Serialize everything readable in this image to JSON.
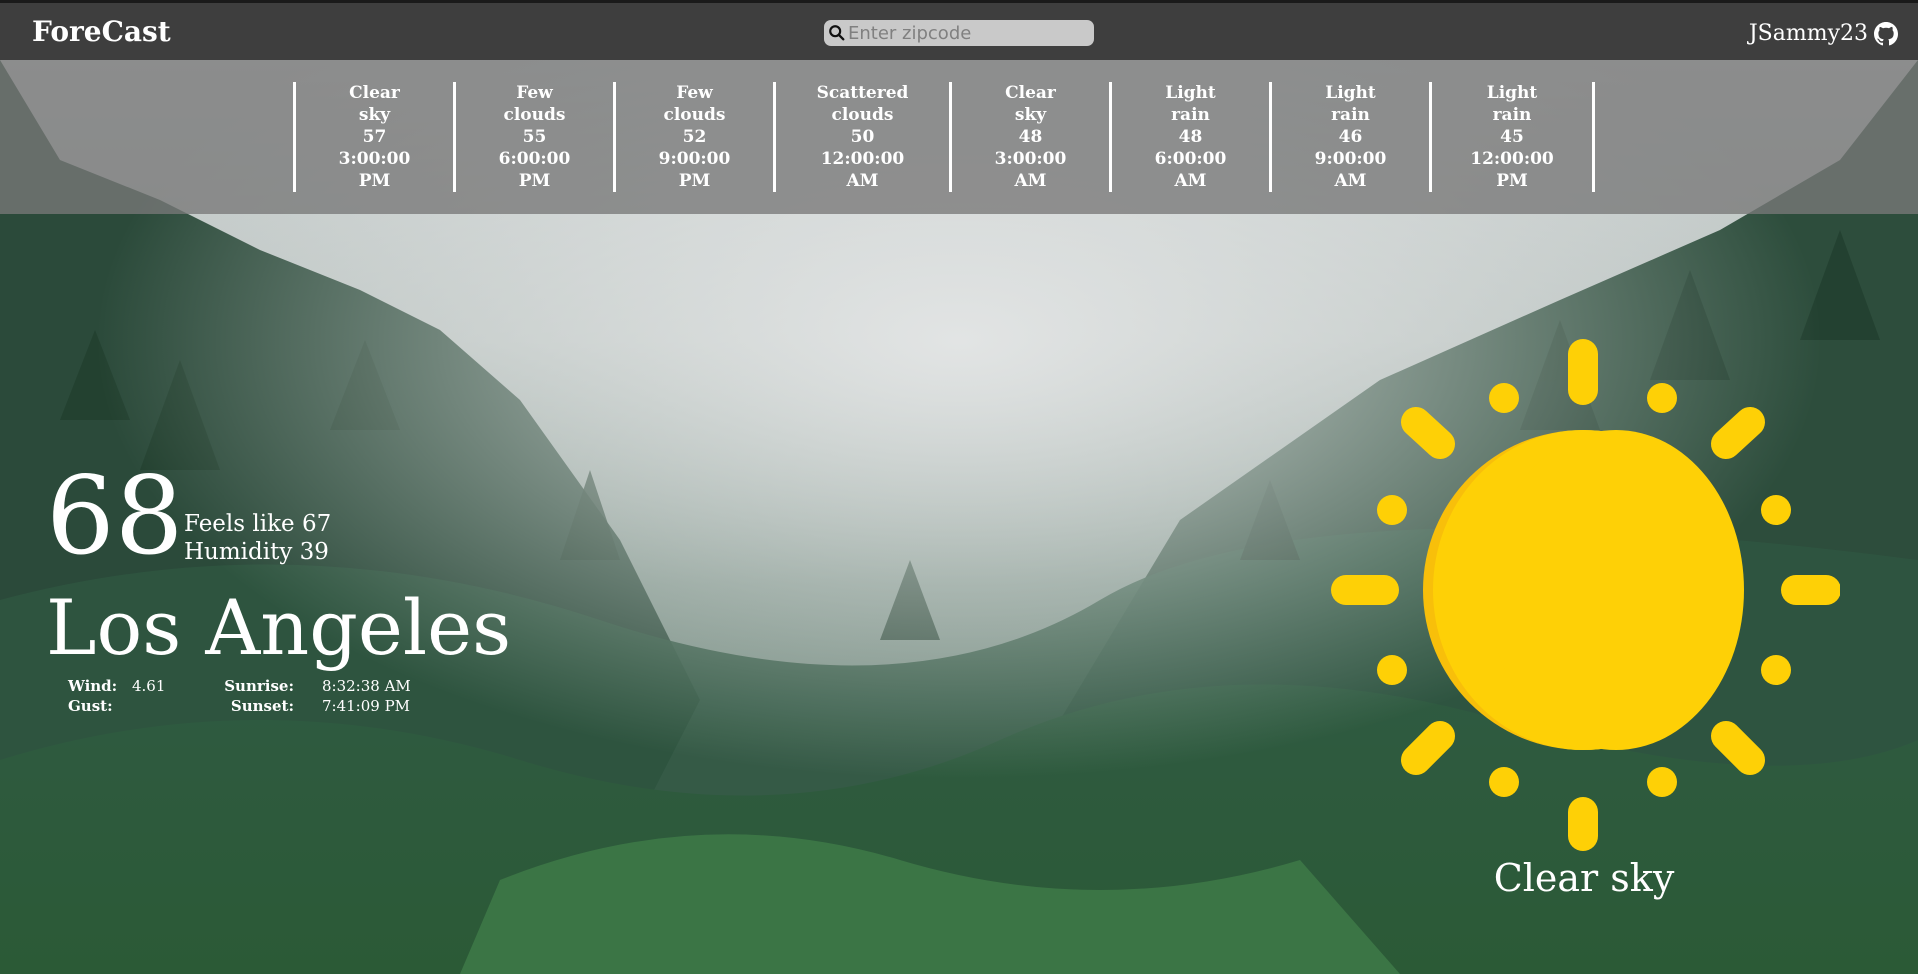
{
  "header": {
    "brand": "ForeCast",
    "search_placeholder": "Enter zipcode",
    "user": "JSammy23"
  },
  "forecast": [
    {
      "condition_1": "Clear",
      "condition_2": "sky",
      "temp": "57",
      "time": "3:00:00",
      "ampm": "PM"
    },
    {
      "condition_1": "Few",
      "condition_2": "clouds",
      "temp": "55",
      "time": "6:00:00",
      "ampm": "PM"
    },
    {
      "condition_1": "Few",
      "condition_2": "clouds",
      "temp": "52",
      "time": "9:00:00",
      "ampm": "PM"
    },
    {
      "condition_1": "Scattered",
      "condition_2": "clouds",
      "temp": "50",
      "time": "12:00:00",
      "ampm": "AM"
    },
    {
      "condition_1": "Clear",
      "condition_2": "sky",
      "temp": "48",
      "time": "3:00:00",
      "ampm": "AM"
    },
    {
      "condition_1": "Light",
      "condition_2": "rain",
      "temp": "48",
      "time": "6:00:00",
      "ampm": "AM"
    },
    {
      "condition_1": "Light",
      "condition_2": "rain",
      "temp": "46",
      "time": "9:00:00",
      "ampm": "AM"
    },
    {
      "condition_1": "Light",
      "condition_2": "rain",
      "temp": "45",
      "time": "12:00:00",
      "ampm": "PM"
    }
  ],
  "current": {
    "temperature": "68",
    "feels_like": "Feels like 67",
    "humidity": "Humidity 39",
    "city": "Los Angeles",
    "wind_label": "Wind:",
    "wind_value": "4.61",
    "gust_label": "Gust:",
    "gust_value": "",
    "sunrise_label": "Sunrise:",
    "sunrise_value": "8:32:38 AM",
    "sunset_label": "Sunset:",
    "sunset_value": "7:41:09 PM",
    "condition": "Clear sky",
    "condition_icon": "sun-icon"
  },
  "colors": {
    "topbar": "#3e3e3e",
    "search_bg": "#c9c9c9",
    "sun": "#fed006",
    "sun_shade": "#f8bf0a",
    "forest_dark": "#1e3a2a",
    "fog": "#d8dcdd"
  }
}
